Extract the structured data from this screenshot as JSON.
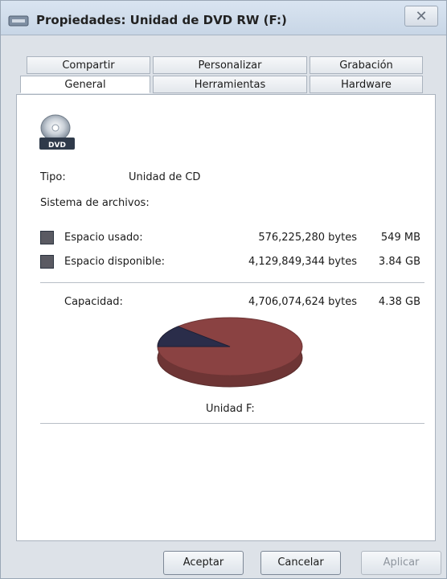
{
  "window": {
    "title": "Propiedades: Unidad de DVD RW (F:)",
    "close_glyph": "✕"
  },
  "tabs": {
    "row1": [
      "Compartir",
      "Personalizar",
      "Grabación"
    ],
    "row2": [
      "General",
      "Herramientas",
      "Hardware"
    ],
    "active": "General"
  },
  "general": {
    "icon_label": "DVD",
    "tipo_label": "Tipo:",
    "tipo_value": "Unidad de CD",
    "fs_label": "Sistema de archivos:",
    "used": {
      "label": "Espacio usado:",
      "bytes": "576,225,280 bytes",
      "size": "549 MB"
    },
    "free": {
      "label": "Espacio disponible:",
      "bytes": "4,129,849,344 bytes",
      "size": "3.84 GB"
    },
    "capacity": {
      "label": "Capacidad:",
      "bytes": "4,706,074,624 bytes",
      "size": "4.38 GB"
    },
    "drive_label": "Unidad F:"
  },
  "pie": {
    "used_fraction": 0.1224,
    "used_color": "#2a2d4a",
    "free_color": "#8a4242"
  },
  "buttons": {
    "ok": "Aceptar",
    "cancel": "Cancelar",
    "apply": "Aplicar"
  }
}
